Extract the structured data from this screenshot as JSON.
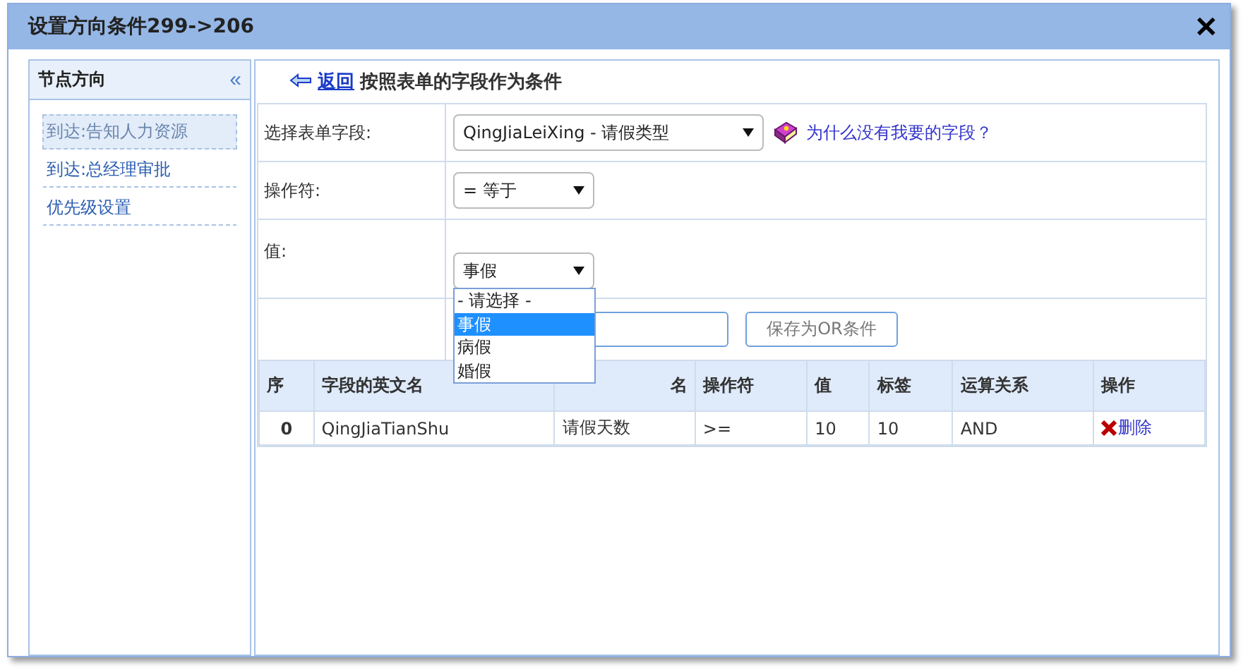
{
  "window": {
    "title": "设置方向条件299->206",
    "close": "✕"
  },
  "sidebar": {
    "title": "节点方向",
    "collapse": "«",
    "items": [
      {
        "label": "到达:告知人力资源",
        "selected": true
      },
      {
        "label": "到达:总经理审批",
        "selected": false
      },
      {
        "label": "优先级设置",
        "selected": false
      }
    ]
  },
  "header": {
    "back": "返回",
    "title": "按照表单的字段作为条件"
  },
  "form": {
    "field_label": "选择表单字段:",
    "field_value": "QingJiaLeiXing - 请假类型",
    "help_link": "为什么没有我要的字段？",
    "operator_label": "操作符:",
    "operator_value": "= 等于",
    "value_label": "值:",
    "value_value": "事假",
    "value_options": [
      {
        "label": "- 请选择 -",
        "selected": false
      },
      {
        "label": "事假",
        "selected": true
      },
      {
        "label": "病假",
        "selected": false
      },
      {
        "label": "婚假",
        "selected": false
      }
    ],
    "or_button": "保存为OR条件"
  },
  "table": {
    "columns": [
      "序",
      "字段的英文名",
      "名",
      "操作符",
      "值",
      "标签",
      "运算关系",
      "操作"
    ],
    "rows": [
      {
        "index": "0",
        "field": "QingJiaTianShu",
        "name": "请假天数",
        "operator": ">=",
        "value": "10",
        "tag": "10",
        "relation": "AND",
        "action": "删除"
      }
    ]
  }
}
